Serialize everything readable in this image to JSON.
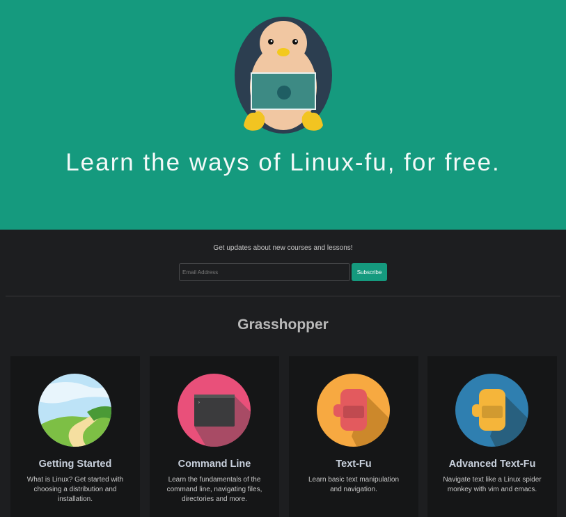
{
  "hero": {
    "title": "Learn the ways of Linux-fu, for free.",
    "background_color": "#159a7e",
    "mascot": "penguin-with-laptop-icon"
  },
  "newsletter": {
    "text": "Get updates about new courses and lessons!",
    "email_placeholder": "Email Address",
    "subscribe_label": "Subscribe"
  },
  "section": {
    "title": "Grasshopper"
  },
  "courses": [
    {
      "title": "Getting Started",
      "description": "What is Linux? Get started with choosing a distribution and installation.",
      "icon": "landscape-icon"
    },
    {
      "title": "Command Line",
      "description": "Learn the fundamentals of the command line, navigating files, directories and more.",
      "icon": "terminal-icon"
    },
    {
      "title": "Text-Fu",
      "description": "Learn basic text manipulation and navigation.",
      "icon": "fist-icon"
    },
    {
      "title": "Advanced Text-Fu",
      "description": "Navigate text like a Linux spider monkey with vim and emacs.",
      "icon": "advanced-fist-icon"
    }
  ]
}
